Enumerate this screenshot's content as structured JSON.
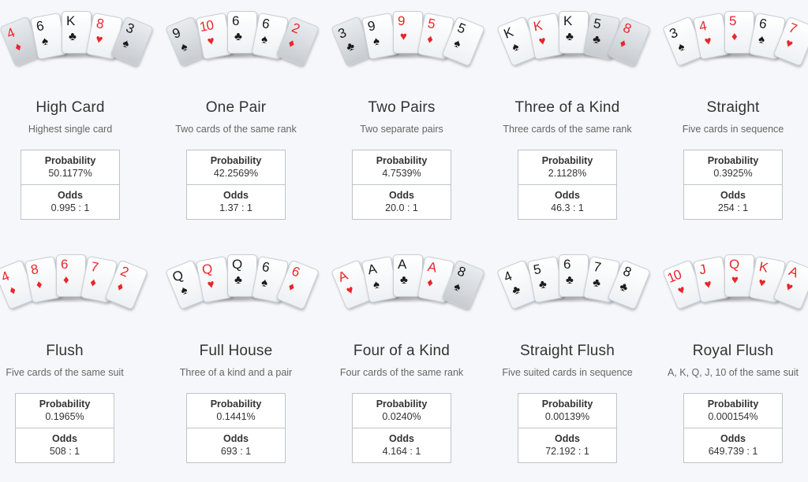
{
  "hands": [
    {
      "name": "High Card",
      "description": "Highest single card",
      "probability_label": "Probability",
      "probability": "50.1177%",
      "odds_label": "Odds",
      "odds": "0.995 : 1",
      "cards": [
        {
          "rank": "4",
          "suit": "♦",
          "color": "red",
          "dim": true
        },
        {
          "rank": "6",
          "suit": "♠",
          "color": "black"
        },
        {
          "rank": "K",
          "suit": "♣",
          "color": "black"
        },
        {
          "rank": "8",
          "suit": "♥",
          "color": "red"
        },
        {
          "rank": "3",
          "suit": "♠",
          "color": "black",
          "dim": true
        }
      ]
    },
    {
      "name": "One Pair",
      "description": "Two cards of the same rank",
      "probability_label": "Probability",
      "probability": "42.2569%",
      "odds_label": "Odds",
      "odds": "1.37 : 1",
      "cards": [
        {
          "rank": "9",
          "suit": "♠",
          "color": "black",
          "dim": true
        },
        {
          "rank": "10",
          "suit": "♥",
          "color": "red"
        },
        {
          "rank": "6",
          "suit": "♣",
          "color": "black"
        },
        {
          "rank": "6",
          "suit": "♠",
          "color": "black"
        },
        {
          "rank": "2",
          "suit": "♦",
          "color": "red",
          "dim": true
        }
      ]
    },
    {
      "name": "Two Pairs",
      "description": "Two separate pairs",
      "probability_label": "Probability",
      "probability": "4.7539%",
      "odds_label": "Odds",
      "odds": "20.0 : 1",
      "cards": [
        {
          "rank": "3",
          "suit": "♣",
          "color": "black",
          "dim": true
        },
        {
          "rank": "9",
          "suit": "♠",
          "color": "black"
        },
        {
          "rank": "9",
          "suit": "♥",
          "color": "red"
        },
        {
          "rank": "5",
          "suit": "♦",
          "color": "red"
        },
        {
          "rank": "5",
          "suit": "♠",
          "color": "black"
        }
      ]
    },
    {
      "name": "Three of a Kind",
      "description": "Three cards of the same rank",
      "probability_label": "Probability",
      "probability": "2.1128%",
      "odds_label": "Odds",
      "odds": "46.3 : 1",
      "cards": [
        {
          "rank": "K",
          "suit": "♠",
          "color": "black"
        },
        {
          "rank": "K",
          "suit": "♥",
          "color": "red"
        },
        {
          "rank": "K",
          "suit": "♣",
          "color": "black"
        },
        {
          "rank": "5",
          "suit": "♣",
          "color": "black",
          "dim": true
        },
        {
          "rank": "8",
          "suit": "♦",
          "color": "red",
          "dim": true
        }
      ]
    },
    {
      "name": "Straight",
      "description": "Five cards in sequence",
      "probability_label": "Probability",
      "probability": "0.3925%",
      "odds_label": "Odds",
      "odds": "254 : 1",
      "cards": [
        {
          "rank": "3",
          "suit": "♠",
          "color": "black"
        },
        {
          "rank": "4",
          "suit": "♥",
          "color": "red"
        },
        {
          "rank": "5",
          "suit": "♦",
          "color": "red"
        },
        {
          "rank": "6",
          "suit": "♠",
          "color": "black"
        },
        {
          "rank": "7",
          "suit": "♥",
          "color": "red"
        }
      ]
    },
    {
      "name": "Flush",
      "description": "Five cards of the same suit",
      "probability_label": "Probability",
      "probability": "0.1965%",
      "odds_label": "Odds",
      "odds": "508 : 1",
      "cards": [
        {
          "rank": "4",
          "suit": "♦",
          "color": "red"
        },
        {
          "rank": "8",
          "suit": "♦",
          "color": "red"
        },
        {
          "rank": "6",
          "suit": "♦",
          "color": "red"
        },
        {
          "rank": "7",
          "suit": "♦",
          "color": "red"
        },
        {
          "rank": "2",
          "suit": "♦",
          "color": "red"
        }
      ]
    },
    {
      "name": "Full House",
      "description": "Three of a kind and a pair",
      "probability_label": "Probability",
      "probability": "0.1441%",
      "odds_label": "Odds",
      "odds": "693 : 1",
      "cards": [
        {
          "rank": "Q",
          "suit": "♠",
          "color": "black"
        },
        {
          "rank": "Q",
          "suit": "♥",
          "color": "red"
        },
        {
          "rank": "Q",
          "suit": "♣",
          "color": "black"
        },
        {
          "rank": "6",
          "suit": "♠",
          "color": "black"
        },
        {
          "rank": "6",
          "suit": "♦",
          "color": "red"
        }
      ]
    },
    {
      "name": "Four of a Kind",
      "description": "Four cards of the same rank",
      "probability_label": "Probability",
      "probability": "0.0240%",
      "odds_label": "Odds",
      "odds": "4.164 : 1",
      "cards": [
        {
          "rank": "A",
          "suit": "♥",
          "color": "red"
        },
        {
          "rank": "A",
          "suit": "♠",
          "color": "black"
        },
        {
          "rank": "A",
          "suit": "♣",
          "color": "black"
        },
        {
          "rank": "A",
          "suit": "♦",
          "color": "red"
        },
        {
          "rank": "8",
          "suit": "♠",
          "color": "black",
          "dim": true
        }
      ]
    },
    {
      "name": "Straight Flush",
      "description": "Five suited cards in sequence",
      "probability_label": "Probability",
      "probability": "0.00139%",
      "odds_label": "Odds",
      "odds": "72.192 : 1",
      "cards": [
        {
          "rank": "4",
          "suit": "♣",
          "color": "black"
        },
        {
          "rank": "5",
          "suit": "♣",
          "color": "black"
        },
        {
          "rank": "6",
          "suit": "♣",
          "color": "black"
        },
        {
          "rank": "7",
          "suit": "♣",
          "color": "black"
        },
        {
          "rank": "8",
          "suit": "♣",
          "color": "black"
        }
      ]
    },
    {
      "name": "Royal Flush",
      "description": "A, K, Q, J, 10 of the same suit",
      "probability_label": "Probability",
      "probability": "0.000154%",
      "odds_label": "Odds",
      "odds": "649.739 : 1",
      "cards": [
        {
          "rank": "10",
          "suit": "♥",
          "color": "red"
        },
        {
          "rank": "J",
          "suit": "♥",
          "color": "red"
        },
        {
          "rank": "Q",
          "suit": "♥",
          "color": "red"
        },
        {
          "rank": "K",
          "suit": "♥",
          "color": "red"
        },
        {
          "rank": "A",
          "suit": "♥",
          "color": "red"
        }
      ]
    }
  ]
}
